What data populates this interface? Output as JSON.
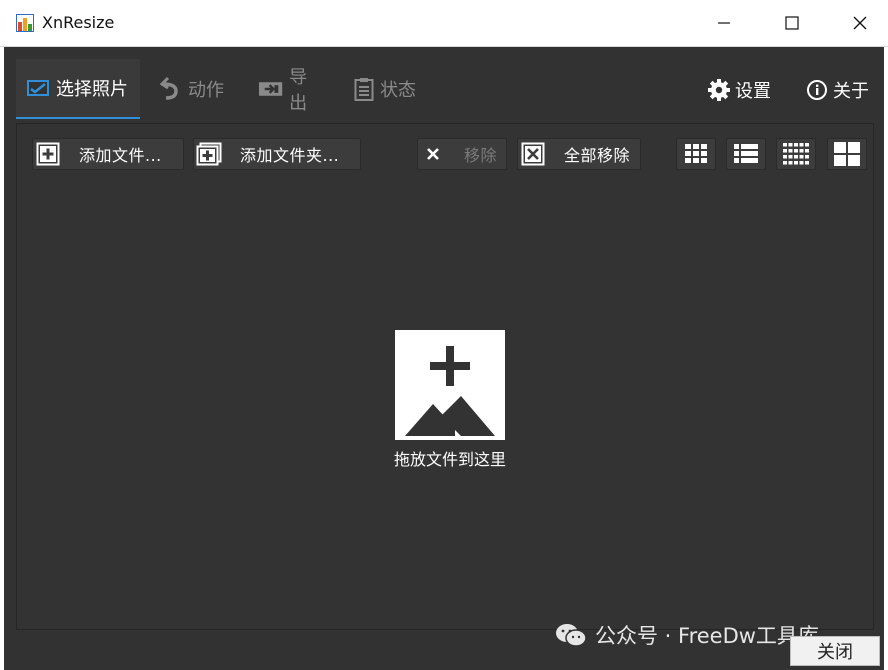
{
  "window": {
    "title": "XnResize",
    "controls": [
      "minimize",
      "maximize",
      "close"
    ]
  },
  "tabs": [
    {
      "label": "选择照片",
      "icon": "image-select-icon",
      "active": true
    },
    {
      "label": "动作",
      "icon": "action-icon",
      "active": false
    },
    {
      "label": "导出",
      "icon": "export-icon",
      "active": false
    },
    {
      "label": "状态",
      "icon": "clipboard-icon",
      "active": false
    }
  ],
  "header_links": {
    "settings": "设置",
    "about": "关于"
  },
  "toolbar": {
    "add_files": "添加文件...",
    "add_folder": "添加文件夹...",
    "remove": "移除",
    "remove_all": "全部移除"
  },
  "dropzone": {
    "text": "拖放文件到这里"
  },
  "watermark": {
    "text": "公众号 · FreeDw工具库"
  },
  "footer": {
    "close": "关闭"
  },
  "colors": {
    "background": "#323232",
    "panel": "#333333",
    "accent": "#2f8fd8"
  }
}
